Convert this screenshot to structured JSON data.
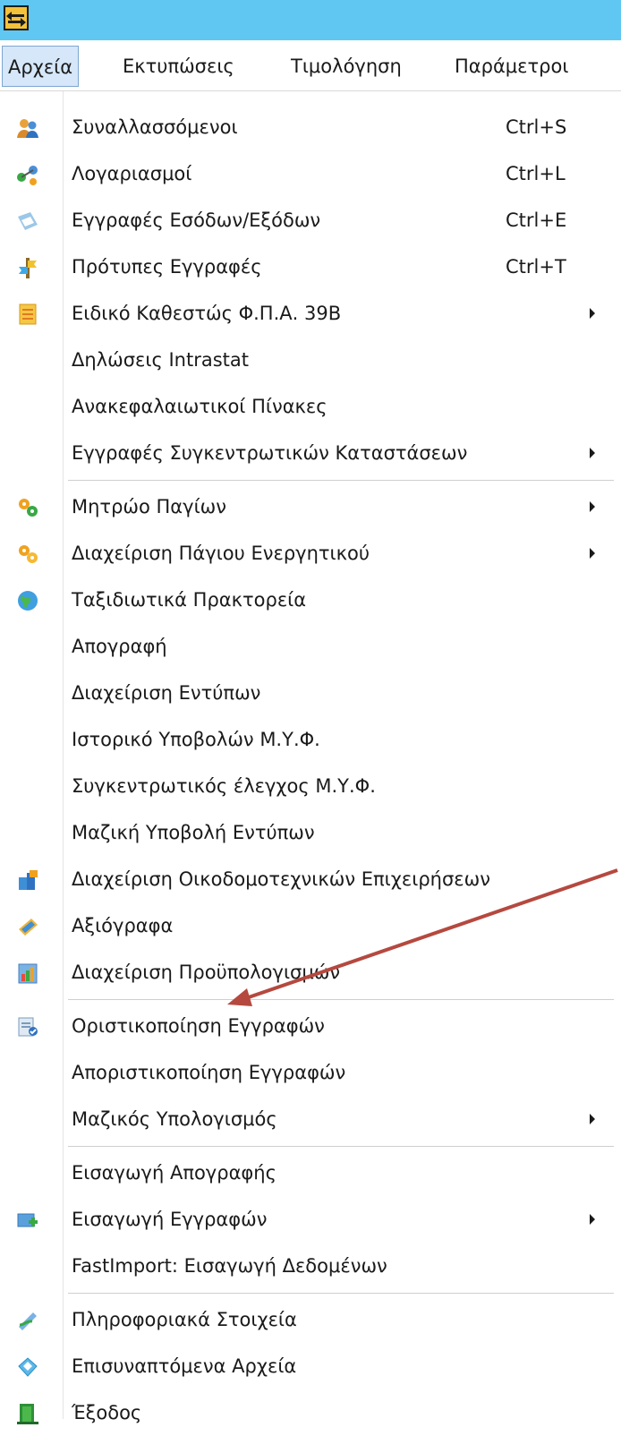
{
  "menubar": {
    "items": [
      "Αρχεία",
      "Εκτυπώσεις",
      "Τιμολόγηση",
      "Παράμετροι"
    ]
  },
  "menu": {
    "items": [
      {
        "label": "Συναλλασσόμενοι",
        "shortcut": "Ctrl+S",
        "icon": "users-icon"
      },
      {
        "label": "Λογαριασμοί",
        "shortcut": "Ctrl+L",
        "icon": "accounts-icon"
      },
      {
        "label": "Εγγραφές Εσόδων/Εξόδων",
        "shortcut": "Ctrl+E",
        "icon": "entries-icon"
      },
      {
        "label": "Πρότυπες Εγγραφές",
        "shortcut": "Ctrl+T",
        "icon": "template-icon"
      },
      {
        "label": "Ειδικό Καθεστώς Φ.Π.Α. 39Β",
        "icon": "document-icon",
        "submenu": true
      },
      {
        "label": "Δηλώσεις Intrastat"
      },
      {
        "label": "Ανακεφαλαιωτικοί Πίνακες"
      },
      {
        "label": "Εγγραφές Συγκεντρωτικών Καταστάσεων",
        "submenu": true
      },
      {
        "label": "Μητρώο Παγίων",
        "icon": "gears-icon",
        "submenu": true
      },
      {
        "label": "Διαχείριση Πάγιου Ενεργητικού",
        "icon": "gears-icon",
        "submenu": true
      },
      {
        "label": "Ταξιδιωτικά Πρακτορεία",
        "icon": "globe-icon"
      },
      {
        "label": "Απογραφή"
      },
      {
        "label": "Διαχείριση Εντύπων"
      },
      {
        "label": "Ιστορικό Υποβολών Μ.Υ.Φ."
      },
      {
        "label": "Συγκεντρωτικός έλεγχος Μ.Υ.Φ."
      },
      {
        "label": "Μαζική Υποβολή Εντύπων"
      },
      {
        "label": "Διαχείριση Οικοδομοτεχνικών Επιχειρήσεων",
        "icon": "construction-icon"
      },
      {
        "label": "Αξιόγραφα",
        "icon": "cheque-icon"
      },
      {
        "label": "Διαχείριση Προϋπολογισμών",
        "icon": "budget-icon"
      },
      {
        "label": "Οριστικοποίηση Εγγραφών",
        "icon": "finalize-icon"
      },
      {
        "label": "Αποριστικοποίηση Εγγραφών"
      },
      {
        "label": "Μαζικός Υπολογισμός",
        "submenu": true
      },
      {
        "label": "Εισαγωγή Απογραφής"
      },
      {
        "label": "Εισαγωγή Εγγραφών",
        "icon": "import-icon",
        "submenu": true
      },
      {
        "label": "FastImport: Εισαγωγή Δεδομένων"
      },
      {
        "label": "Πληροφοριακά Στοιχεία",
        "icon": "info-icon"
      },
      {
        "label": "Επισυναπτόμενα Αρχεία",
        "icon": "attachments-icon"
      },
      {
        "label": "Έξοδος",
        "icon": "exit-icon"
      }
    ]
  },
  "colors": {
    "titlebar": "#5fc7f2",
    "menubar_active_bg": "#d5e7f8",
    "annotation_arrow": "#b5493f"
  }
}
